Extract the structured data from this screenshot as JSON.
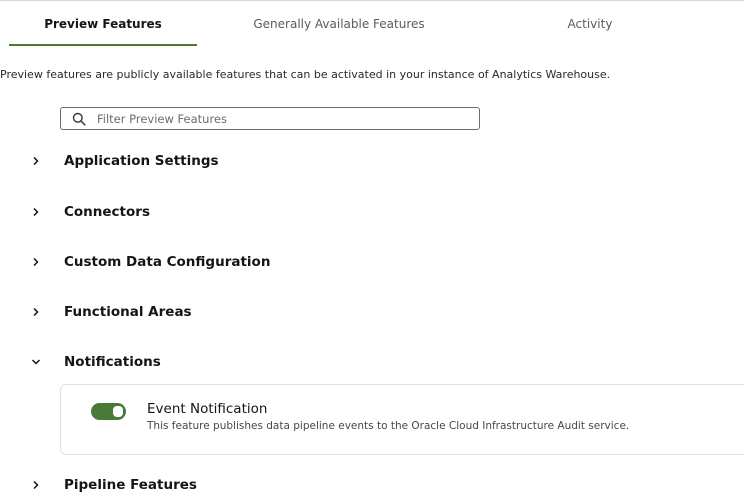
{
  "tabs": [
    {
      "label": "Preview Features",
      "active": true
    },
    {
      "label": "Generally Available Features",
      "active": false
    },
    {
      "label": "Activity",
      "active": false
    }
  ],
  "description": "Preview features are publicly available features that can be activated in your instance of Analytics Warehouse.",
  "search": {
    "placeholder": "Filter Preview Features",
    "value": "",
    "icon": "search-icon"
  },
  "sections": [
    {
      "label": "Application Settings",
      "expanded": false
    },
    {
      "label": "Connectors",
      "expanded": false
    },
    {
      "label": "Custom Data Configuration",
      "expanded": false
    },
    {
      "label": "Functional Areas",
      "expanded": false
    },
    {
      "label": "Notifications",
      "expanded": true
    },
    {
      "label": "Pipeline Features",
      "expanded": false
    }
  ],
  "notification_feature": {
    "title": "Event Notification",
    "description": "This feature publishes data pipeline events to the Oracle Cloud Infrastructure Audit service.",
    "enabled": true
  },
  "colors": {
    "accent": "#4a7a3a",
    "text": "#161513",
    "muted": "#5e5b58",
    "border": "#e2e0dd"
  }
}
